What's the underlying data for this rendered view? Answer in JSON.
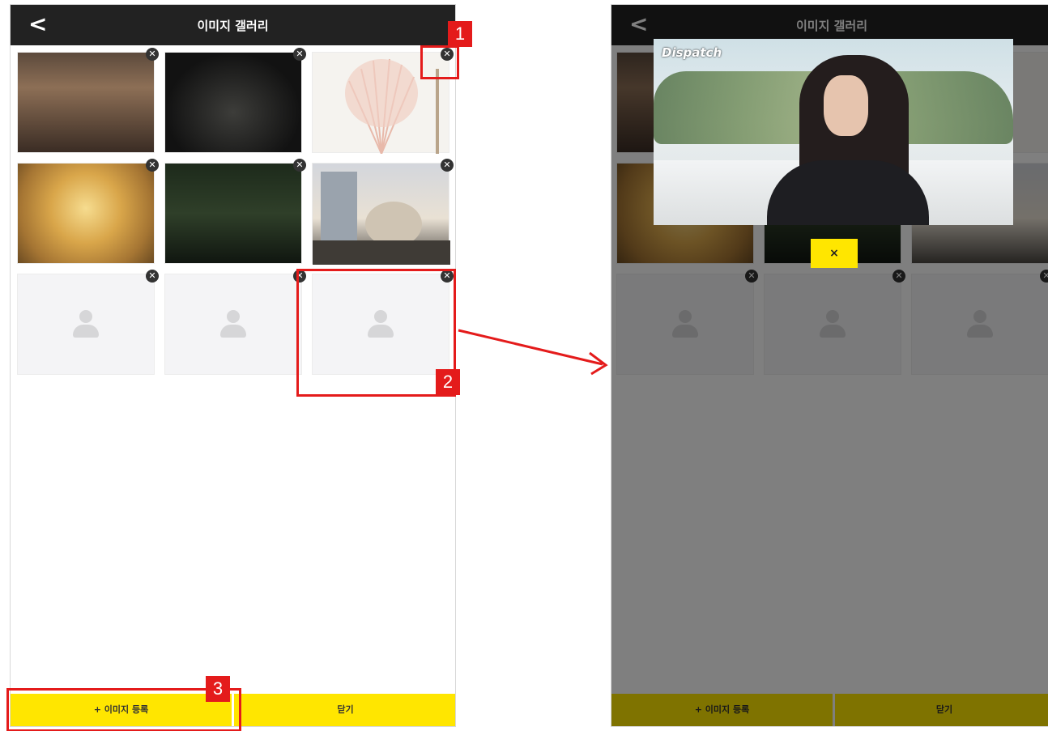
{
  "left_screen": {
    "title": "이미지 갤러리",
    "back_icon": "chevron-left-icon",
    "delete_icon": "close-circle-icon",
    "delete_glyph": "✕",
    "register_button": "+ 이미지 등록",
    "close_button": "닫기"
  },
  "right_screen": {
    "title": "이미지 갤러리",
    "popup_watermark": "Dispatch",
    "popup_close": "×",
    "register_button": "+ 이미지 등록",
    "close_button": "닫기"
  },
  "annotations": [
    "1",
    "2",
    "3"
  ],
  "colors": {
    "accent_yellow": "#ffe600",
    "header_dark": "#222222",
    "annotation_red": "#e41b1b"
  }
}
